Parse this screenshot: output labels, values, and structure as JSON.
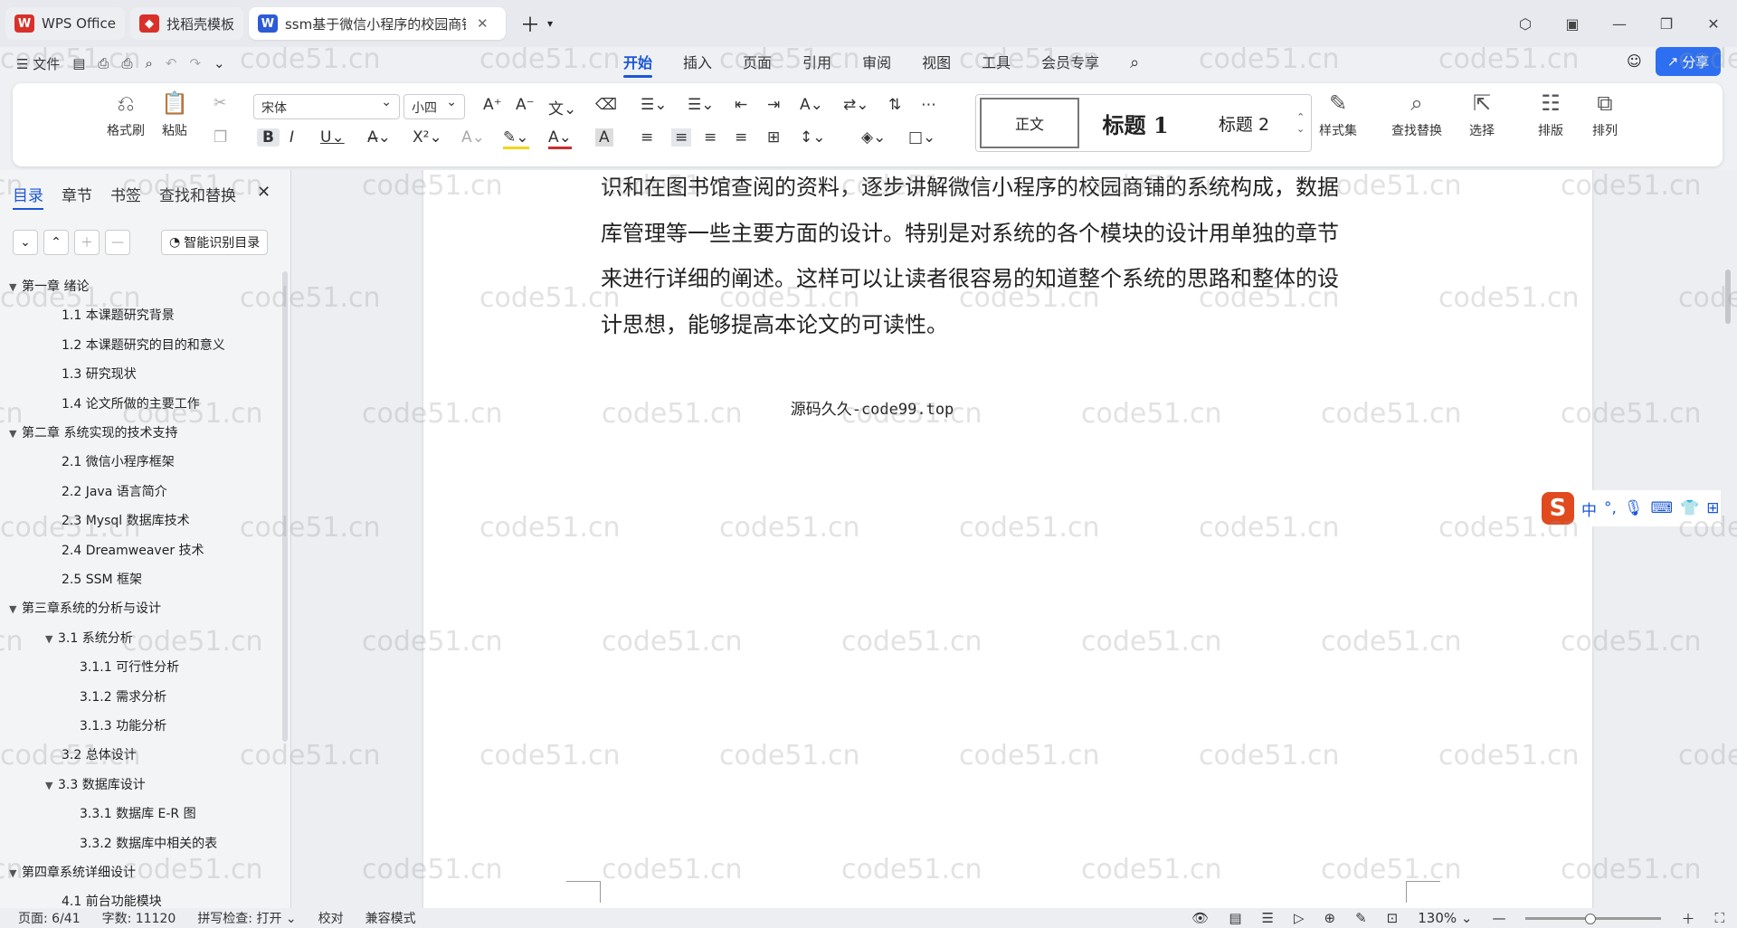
{
  "tabs": [
    {
      "label": "WPS Office",
      "color": "#d9312a",
      "logo": "W"
    },
    {
      "label": "找稻壳模板",
      "color": "#d9312a",
      "logo": "◆"
    },
    {
      "label": "ssm基于微信小程序的校园商铺",
      "color": "#2d5bd6",
      "logo": "W"
    }
  ],
  "menu": {
    "file": "文件",
    "tabs": [
      "开始",
      "插入",
      "页面",
      "引用",
      "审阅",
      "视图",
      "工具",
      "会员专享"
    ],
    "share": "分享"
  },
  "ribbon": {
    "format_painter": "格式刷",
    "paste": "粘贴",
    "font": "宋体",
    "size": "小四",
    "styles": [
      "正文",
      "标题 1",
      "标题 2"
    ],
    "style_set": "样式集",
    "find_replace": "查找替换",
    "select": "选择",
    "layout": "排版",
    "arrange": "排列"
  },
  "nav": {
    "tabs": [
      "目录",
      "章节",
      "书签",
      "查找和替换"
    ],
    "smart": "智能识别目录",
    "toc": [
      {
        "text": "第一章 绪论",
        "level": 0,
        "arrow": "▼"
      },
      {
        "text": "1.1 本课题研究背景",
        "level": 1
      },
      {
        "text": "1.2 本课题研究的目的和意义",
        "level": 1
      },
      {
        "text": "1.3 研究现状",
        "level": 1
      },
      {
        "text": "1.4 论文所做的主要工作",
        "level": 1
      },
      {
        "text": "第二章 系统实现的技术支持",
        "level": 0,
        "arrow": "▼"
      },
      {
        "text": "2.1 微信小程序框架",
        "level": 1
      },
      {
        "text": "2.2 Java 语言简介",
        "level": 1
      },
      {
        "text": "2.3 Mysql 数据库技术",
        "level": 1
      },
      {
        "text": "2.4 Dreamweaver 技术",
        "level": 1
      },
      {
        "text": "2.5 SSM 框架",
        "level": 1
      },
      {
        "text": "第三章系统的分析与设计",
        "level": 0,
        "arrow": "▼"
      },
      {
        "text": "3.1 系统分析",
        "level": 1,
        "arrow": "▼"
      },
      {
        "text": "3.1.1 可行性分析",
        "level": 2
      },
      {
        "text": "3.1.2 需求分析",
        "level": 2
      },
      {
        "text": "3.1.3  功能分析",
        "level": 2
      },
      {
        "text": "3.2 总体设计",
        "level": 1
      },
      {
        "text": "3.3 数据库设计",
        "level": 1,
        "arrow": "▼"
      },
      {
        "text": "3.3.1  数据库 E-R 图",
        "level": 2
      },
      {
        "text": "3.3.2  数据库中相关的表",
        "level": 2
      },
      {
        "text": "第四章系统详细设计",
        "level": 0,
        "arrow": "▼"
      },
      {
        "text": "4.1 前台功能模块",
        "level": 1
      }
    ]
  },
  "doc": {
    "lines": [
      "识和在图书馆查阅的资料，逐步讲解微信小程序的校园商铺的系统构成，数据",
      "库管理等一些主要方面的设计。特别是对系统的各个模块的设计用单独的章节",
      "来进行详细的阐述。这样可以让读者很容易的知道整个系统的思路和整体的设",
      "计思想，能够提高本论文的可读性。"
    ],
    "centered": "源码久久-code99.top"
  },
  "ime": {
    "mode": "中"
  },
  "status": {
    "page": "页面: 6/41",
    "words": "字数: 11120",
    "spell": "拼写检查: 打开",
    "proof": "校对",
    "compat": "兼容模式",
    "zoom": "130%"
  },
  "watermark": "code51.cn"
}
